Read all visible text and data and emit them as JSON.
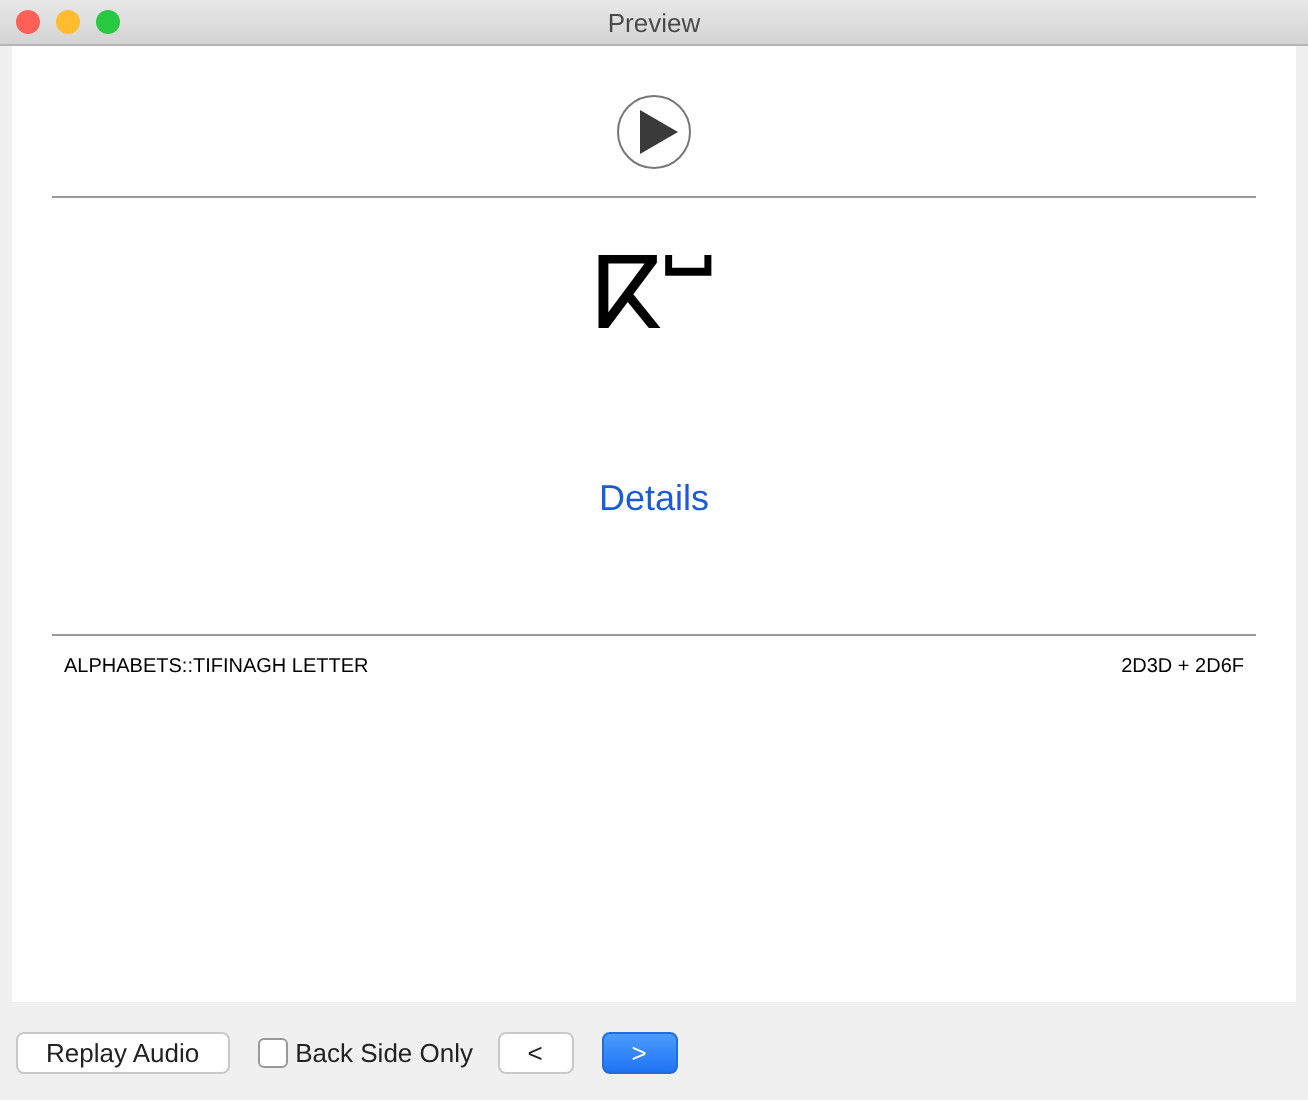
{
  "window": {
    "title": "Preview"
  },
  "card": {
    "glyph": "ⴽⵯ",
    "link": "Details",
    "deck": "ALPHABETS::TIFINAGH LETTER",
    "code": "2D3D + 2D6F"
  },
  "footer": {
    "replay": "Replay Audio",
    "back_side_only": {
      "label": "Back Side Only",
      "checked": false
    },
    "nav": [
      {
        "label": "<",
        "primary": false
      },
      {
        "label": ">",
        "primary": true
      }
    ]
  }
}
